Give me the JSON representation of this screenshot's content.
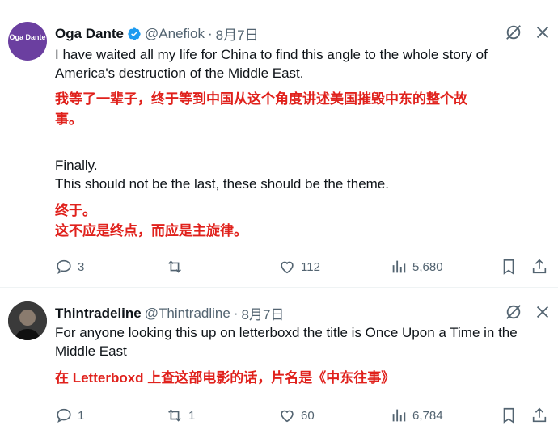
{
  "tweets": [
    {
      "author_name": "Oga Dante",
      "handle": "@Anefiok",
      "separator": "·",
      "date": "8月7日",
      "avatar_text": "Oga Dante",
      "text_lines": [
        "I have waited all my life for China to find this angle to the whole story of",
        "America's destruction of the Middle East."
      ],
      "translation_lines": [
        "我等了一辈子，终于等到中国从这个角度讲述美国摧毁中东的整个故",
        "事。"
      ],
      "text2_lines": [
        "Finally.",
        "This should not be the last, these should be the theme."
      ],
      "translation2_lines": [
        "终于。",
        "这不应是终点，而应是主旋律。"
      ],
      "replies": "3",
      "retweets": "",
      "likes": "112",
      "views": "5,680"
    },
    {
      "author_name": "Thintradeline",
      "handle": "@Thintradline",
      "separator": "·",
      "date": "8月7日",
      "text_lines": [
        "For anyone looking this up on letterboxd the title is Once Upon a Time in the",
        "Middle East"
      ],
      "translation_lines": [
        "在 Letterboxd 上查这部电影的话，片名是《中东往事》"
      ],
      "replies": "1",
      "retweets": "1",
      "likes": "60",
      "views": "6,784"
    }
  ],
  "colors": {
    "verified_blue": "#1d9bf0",
    "translation_red": "#e0211c",
    "muted_gray": "#536471"
  },
  "icons": [
    "grok-icon",
    "more-icon",
    "reply-icon",
    "retweet-icon",
    "like-icon",
    "views-icon",
    "bookmark-icon",
    "share-icon"
  ]
}
